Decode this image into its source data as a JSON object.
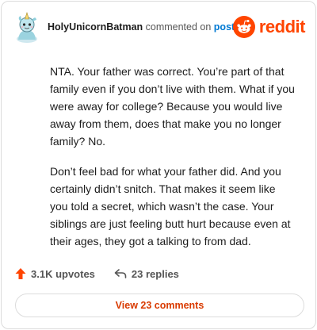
{
  "comment": {
    "username": "HolyUnicornBatman",
    "commented_text": " commented on ",
    "post_link": "post",
    "paragraphs": [
      "NTA. Your father was correct. You’re part of that family even if you don’t live with them. What if you were away for college? Because you would live away from them, does that make you no longer family? No.",
      "Don’t feel bad for what your father did. And you certainly didn’t snitch. That makes it seem like you told a secret, which wasn’t the case. Your siblings are just feeling butt hurt because even at their ages, they got a talking to from dad."
    ],
    "upvotes": "3.1K upvotes",
    "replies": "23 replies",
    "view_button": "View 23 comments"
  },
  "brand": {
    "wordmark": "reddit",
    "accent": "#ff4500",
    "link_color": "#0079d3",
    "button_text_color": "#d93a00"
  },
  "icons": {
    "avatar": "unicorn-avatar-icon",
    "upvote": "upvote-arrow-icon",
    "reply": "reply-arrow-icon",
    "logo": "reddit-snoo-icon"
  }
}
